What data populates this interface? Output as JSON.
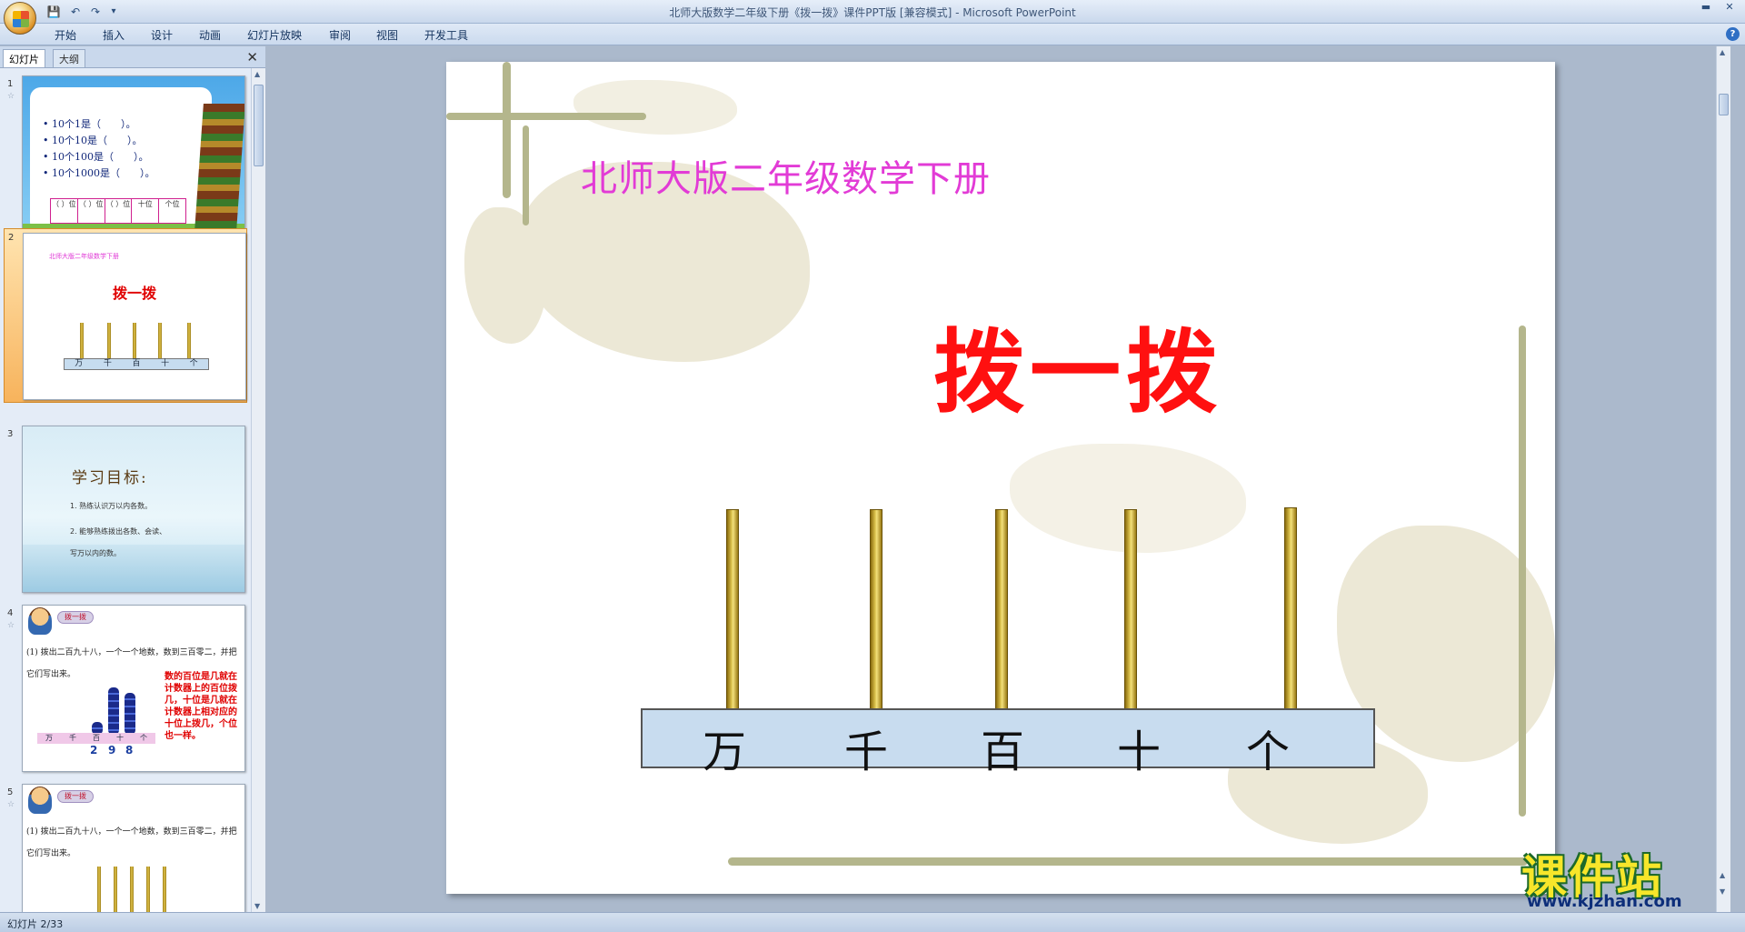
{
  "window": {
    "title": "北师大版数学二年级下册《拨一拨》课件PPT版 [兼容模式] - Microsoft PowerPoint",
    "min_icon": "minimize-icon",
    "close_icon": "close-icon"
  },
  "qat": {
    "save": "save-icon",
    "undo": "undo-icon",
    "redo": "redo-icon",
    "customize": "▾"
  },
  "ribbon": {
    "tabs": [
      "开始",
      "插入",
      "设计",
      "动画",
      "幻灯片放映",
      "审阅",
      "视图",
      "开发工具"
    ]
  },
  "pane": {
    "tab_slides": "幻灯片",
    "tab_outline": "大纲",
    "close": "✕"
  },
  "thumbnails": [
    {
      "number": "1",
      "star": "☆",
      "lines": [
        "• 10个1是（　　）。",
        "• 10个10是（　　）。",
        "• 10个100是（　　）。",
        "• 10个1000是（　　）。"
      ],
      "cells": [
        "（ ）位",
        "（ ）位",
        "（ ）位",
        "十位",
        "个位"
      ]
    },
    {
      "number": "2",
      "star": "",
      "small_title": "北师大版二年级数学下册",
      "title": "拨一拨",
      "places": [
        "万",
        "千",
        "百",
        "十",
        "个"
      ]
    },
    {
      "number": "3",
      "star": "",
      "heading": "学习目标:",
      "items": [
        "1. 熟练认识万以内各数。",
        "2. 能够熟练拨出各数、会读、",
        "写万以内的数。"
      ]
    },
    {
      "number": "4",
      "star": "☆",
      "badge": "拨一拨",
      "question": "(1) 拨出二百九十八，一个一个地数，数到三百零二，并把它们写出来。",
      "note": "数的百位是几就在计数器上的百位拨几，十位是几就在计数器上相对应的十位上拨几，个位也一样。",
      "places": [
        "万",
        "千",
        "百",
        "十",
        "个"
      ],
      "digits": [
        "2",
        "9",
        "8"
      ]
    },
    {
      "number": "5",
      "star": "☆",
      "badge": "拨一拨",
      "question": "(1) 拨出二百九十八，一个一个地数，数到三百零二，并把它们写出来。"
    }
  ],
  "slide": {
    "subtitle": "北师大版二年级数学下册",
    "title": "拨一拨",
    "places": [
      "万",
      "千",
      "百",
      "十",
      "个"
    ]
  },
  "watermark": {
    "main": "课件站",
    "url": "www.kjzhan.com"
  },
  "status": {
    "text": "幻灯片 2/33"
  }
}
